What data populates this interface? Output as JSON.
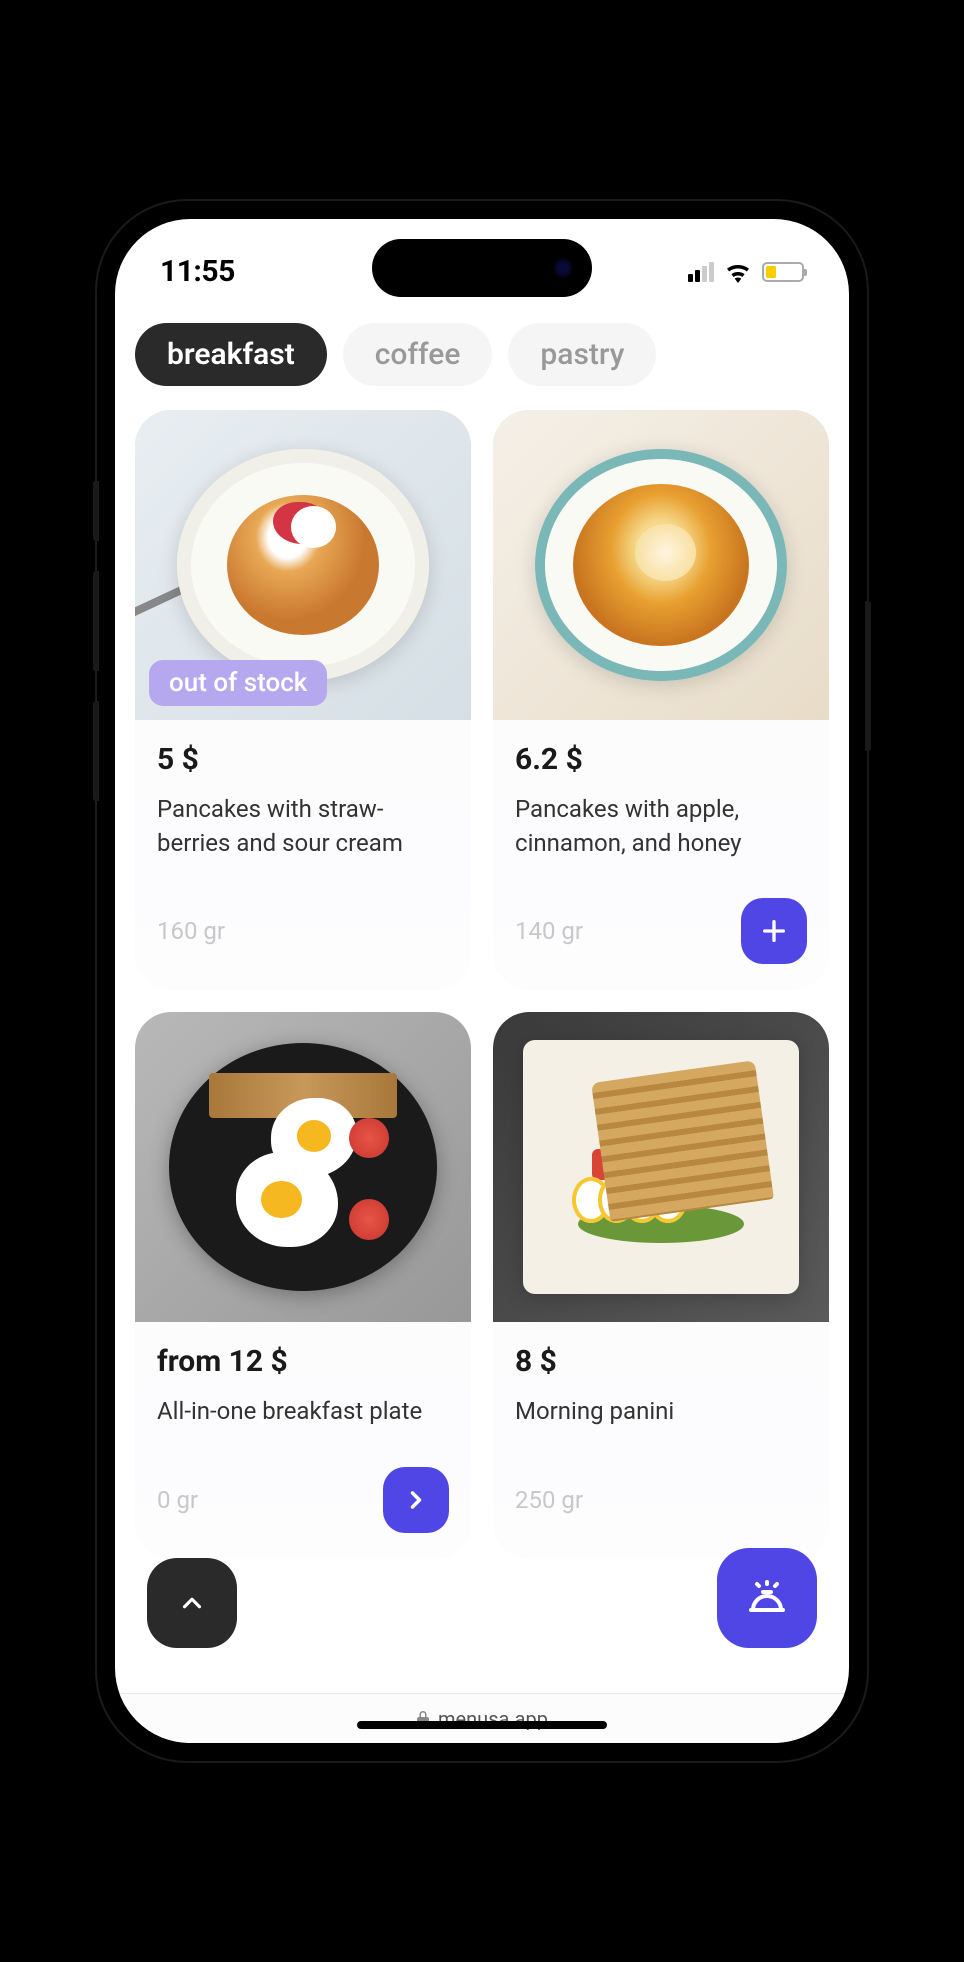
{
  "status": {
    "time": "11:55"
  },
  "tabs": [
    {
      "label": "breakfast",
      "active": true
    },
    {
      "label": "coffee",
      "active": false
    },
    {
      "label": "pastry",
      "active": false
    }
  ],
  "items": [
    {
      "price": "5 $",
      "title": "Pancakes with straw­berries and sour cream",
      "weight": "160 gr",
      "badge": "out of stock",
      "has_add": false,
      "has_arrow": false
    },
    {
      "price": "6.2 $",
      "title": "Pancakes with apple, cinnamon, and honey",
      "weight": "140 gr",
      "badge": null,
      "has_add": true,
      "has_arrow": false
    },
    {
      "price": "from 12 $",
      "title": "All-in-one breakfast plate",
      "weight": "0 gr",
      "badge": null,
      "has_add": false,
      "has_arrow": true
    },
    {
      "price": "8 $",
      "title": "Morning panini",
      "weight": "250 gr",
      "badge": null,
      "has_add": false,
      "has_arrow": false
    }
  ],
  "browser": {
    "domain": "menusa.app"
  },
  "colors": {
    "accent": "#5046e5",
    "dark": "#2a2a2a",
    "badge": "#b5a8ee"
  }
}
